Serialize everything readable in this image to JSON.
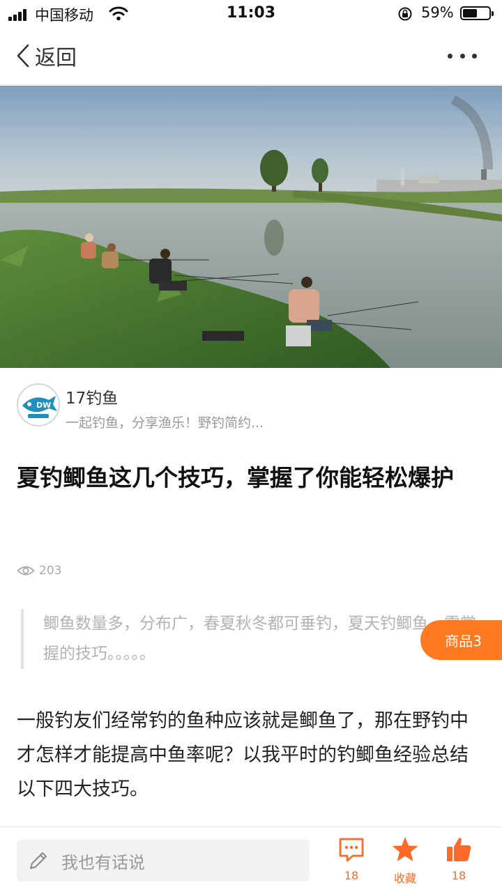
{
  "status_bar": {
    "carrier": "中国移动",
    "time": "11:03",
    "battery_percent_text": "59%",
    "battery_level": 0.59
  },
  "nav": {
    "back_label": "返回"
  },
  "author": {
    "name": "17钓鱼",
    "description": "一起钓鱼，分享渔乐！野钓简约..."
  },
  "article": {
    "title": "夏钓鲫鱼这几个技巧，掌握了你能轻松爆护",
    "views": "203",
    "quote": "鲫鱼数量多，分布广，春夏秋冬都可垂钓，夏天钓鲫鱼，需掌握的技巧。。。。。",
    "body": "一般钓友们经常钓的鱼种应该就是鲫鱼了，那在野钓中才怎样才能提高中鱼率呢？以我平时的钓鲫鱼经验总结以下四大技巧。"
  },
  "goods_badge": "商品3",
  "bottom_bar": {
    "comment_placeholder": "我也有话说",
    "comments_count": "18",
    "favorite_label": "收藏",
    "likes_count": "18"
  },
  "colors": {
    "accent": "#ff6a2a",
    "badge": "#ff7a1f"
  }
}
